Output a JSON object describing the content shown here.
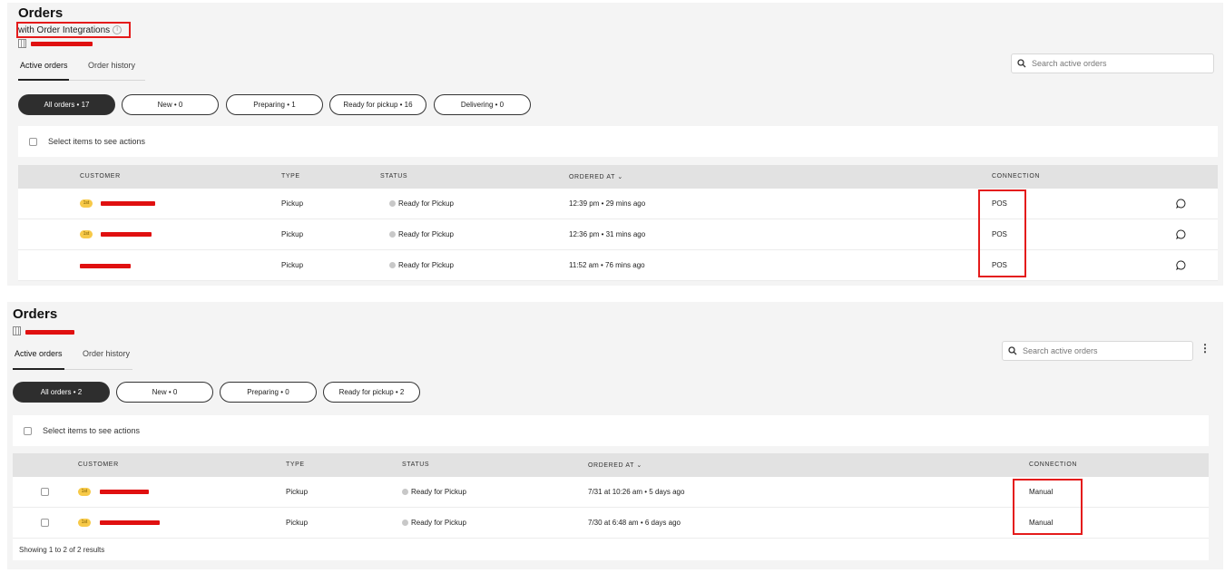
{
  "panel1": {
    "title": "Orders",
    "subtitle": "with Order Integrations",
    "tabs": [
      "Active orders",
      "Order history"
    ],
    "search_placeholder": "Search active orders",
    "filters": [
      "All orders • 17",
      "New • 0",
      "Preparing • 1",
      "Ready for pickup • 16",
      "Delivering • 0"
    ],
    "actions_text": "Select items to see actions",
    "columns": [
      "CUSTOMER",
      "TYPE",
      "STATUS",
      "ORDERED AT ⌄",
      "CONNECTION"
    ],
    "rows": [
      {
        "badge": "1st",
        "type": "Pickup",
        "status": "Ready for Pickup",
        "ordered_at": "12:39 pm • 29 mins ago",
        "connection": "POS"
      },
      {
        "badge": "1st",
        "type": "Pickup",
        "status": "Ready for Pickup",
        "ordered_at": "12:36 pm • 31 mins ago",
        "connection": "POS"
      },
      {
        "badge": "",
        "type": "Pickup",
        "status": "Ready for Pickup",
        "ordered_at": "11:52 am • 76 mins ago",
        "connection": "POS"
      }
    ]
  },
  "panel2": {
    "title": "Orders",
    "tabs": [
      "Active orders",
      "Order history"
    ],
    "search_placeholder": "Search active orders",
    "more_icon": "⋮",
    "filters": [
      "All orders • 2",
      "New • 0",
      "Preparing • 0",
      "Ready for pickup • 2"
    ],
    "actions_text": "Select items to see actions",
    "columns": [
      "CUSTOMER",
      "TYPE",
      "STATUS",
      "ORDERED AT ⌄",
      "CONNECTION"
    ],
    "rows": [
      {
        "badge": "1st",
        "type": "Pickup",
        "status": "Ready for Pickup",
        "ordered_at": "7/31 at 10:26 am • 5 days ago",
        "connection": "Manual"
      },
      {
        "badge": "1st",
        "type": "Pickup",
        "status": "Ready for Pickup",
        "ordered_at": "7/30 at 6:48 am • 6 days ago",
        "connection": "Manual"
      }
    ],
    "footer": "Showing 1 to 2 of 2 results"
  },
  "colors": {
    "annotation": "#e41b1b",
    "active_pill": "#2e2e2e",
    "badge": "#f7c948",
    "redaction": "#e01010"
  }
}
